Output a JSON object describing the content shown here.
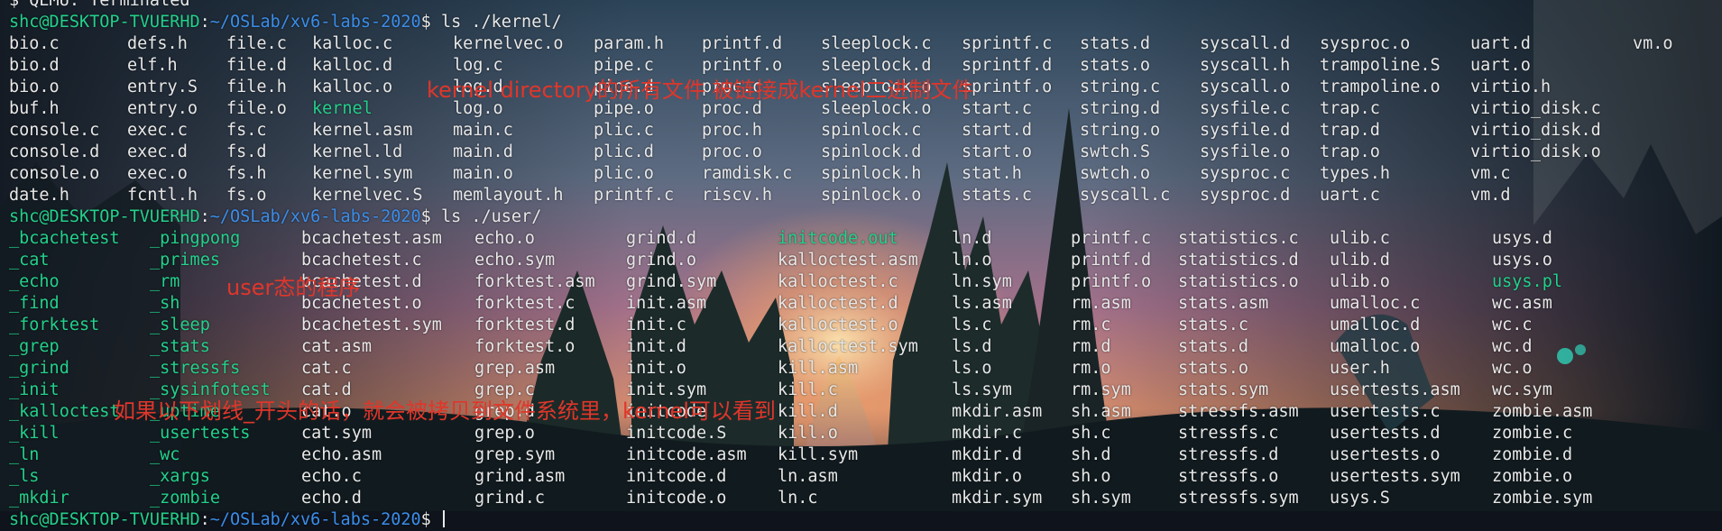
{
  "colors": {
    "exe_green": "#23d18b",
    "path_blue": "#3b8eea",
    "annotation_red": "#e0362a"
  },
  "terminal": {
    "status_line": "$ QEMU: Terminated",
    "kernel_cmd": {
      "user_host": "shc@DESKTOP-TVUERHD",
      "sep": ":",
      "path": "~/OSLab/xv6-labs-2020",
      "command": "$ ls ./kernel/"
    },
    "kernel_rows": [
      [
        "bio.c",
        "defs.h",
        "file.c",
        "kalloc.c",
        "kernelvec.o",
        "param.h",
        "printf.d",
        "sleeplock.c",
        "sprintf.c",
        "stats.d",
        "syscall.d",
        "sysproc.o",
        "uart.d",
        "vm.o"
      ],
      [
        "bio.d",
        "elf.h",
        "file.d",
        "kalloc.d",
        "log.c",
        "pipe.c",
        "printf.o",
        "sleeplock.d",
        "sprintf.d",
        "stats.o",
        "syscall.h",
        "trampoline.S",
        "uart.o",
        ""
      ],
      [
        "bio.o",
        "entry.S",
        "file.h",
        "kalloc.o",
        "log.d",
        "pipe.d",
        "proc.c",
        "sleeplock.o",
        "sprintf.o",
        "string.c",
        "syscall.o",
        "trampoline.o",
        "virtio.h",
        ""
      ],
      [
        "buf.h",
        "entry.o",
        "file.o",
        "kernel",
        "log.o",
        "pipe.o",
        "proc.d",
        "sleeplock.o",
        "start.c",
        "string.d",
        "sysfile.c",
        "trap.c",
        "virtio_disk.c",
        ""
      ],
      [
        "console.c",
        "exec.c",
        "fs.c",
        "kernel.asm",
        "main.c",
        "plic.c",
        "proc.h",
        "spinlock.c",
        "start.d",
        "string.o",
        "sysfile.d",
        "trap.d",
        "virtio_disk.d",
        ""
      ],
      [
        "console.d",
        "exec.d",
        "fs.d",
        "kernel.ld",
        "main.d",
        "plic.d",
        "proc.o",
        "spinlock.d",
        "start.o",
        "swtch.S",
        "sysfile.o",
        "trap.o",
        "virtio_disk.o",
        ""
      ],
      [
        "console.o",
        "exec.o",
        "fs.h",
        "kernel.sym",
        "main.o",
        "plic.o",
        "ramdisk.c",
        "spinlock.h",
        "stat.h",
        "swtch.o",
        "sysproc.c",
        "types.h",
        "vm.c",
        ""
      ],
      [
        "date.h",
        "fcntl.h",
        "fs.o",
        "kernelvec.S",
        "memlayout.h",
        "printf.c",
        "riscv.h",
        "spinlock.o",
        "stats.c",
        "syscall.c",
        "sysproc.d",
        "uart.c",
        "vm.d",
        ""
      ]
    ],
    "user_cmd": {
      "user_host": "shc@DESKTOP-TVUERHD",
      "sep": ":",
      "path": "~/OSLab/xv6-labs-2020",
      "command": "$ ls ./user/"
    },
    "user_rows": [
      [
        "_bcachetest",
        "_pingpong",
        "bcachetest.asm",
        "echo.o",
        "grind.d",
        "initcode.out",
        "ln.d",
        "printf.c",
        "statistics.c",
        "ulib.c",
        "usys.d"
      ],
      [
        "_cat",
        "_primes",
        "bcachetest.c",
        "echo.sym",
        "grind.o",
        "kalloctest.asm",
        "ln.o",
        "printf.d",
        "statistics.d",
        "ulib.d",
        "usys.o"
      ],
      [
        "_echo",
        "_rm",
        "bcachetest.d",
        "forktest.asm",
        "grind.sym",
        "kalloctest.c",
        "ln.sym",
        "printf.o",
        "statistics.o",
        "ulib.o",
        "usys.pl"
      ],
      [
        "_find",
        "_sh",
        "bcachetest.o",
        "forktest.c",
        "init.asm",
        "kalloctest.d",
        "ls.asm",
        "rm.asm",
        "stats.asm",
        "umalloc.c",
        "wc.asm"
      ],
      [
        "_forktest",
        "_sleep",
        "bcachetest.sym",
        "forktest.d",
        "init.c",
        "kalloctest.o",
        "ls.c",
        "rm.c",
        "stats.c",
        "umalloc.d",
        "wc.c"
      ],
      [
        "_grep",
        "_stats",
        "cat.asm",
        "forktest.o",
        "init.d",
        "kalloctest.sym",
        "ls.d",
        "rm.d",
        "stats.d",
        "umalloc.o",
        "wc.d"
      ],
      [
        "_grind",
        "_stressfs",
        "cat.c",
        "grep.asm",
        "init.o",
        "kill.asm",
        "ls.o",
        "rm.o",
        "stats.o",
        "user.h",
        "wc.o"
      ],
      [
        "_init",
        "_sysinfotest",
        "cat.d",
        "grep.c",
        "init.sym",
        "kill.c",
        "ls.sym",
        "rm.sym",
        "stats.sym",
        "usertests.asm",
        "wc.sym"
      ],
      [
        "_kalloctest",
        "_uptime",
        "cat.o",
        "grep.d",
        "initcode",
        "kill.d",
        "mkdir.asm",
        "sh.asm",
        "stressfs.asm",
        "usertests.c",
        "zombie.asm"
      ],
      [
        "_kill",
        "_usertests",
        "cat.sym",
        "grep.o",
        "initcode.S",
        "kill.o",
        "mkdir.c",
        "sh.c",
        "stressfs.c",
        "usertests.d",
        "zombie.c"
      ],
      [
        "_ln",
        "_wc",
        "echo.asm",
        "grep.sym",
        "initcode.asm",
        "kill.sym",
        "mkdir.d",
        "sh.d",
        "stressfs.d",
        "usertests.o",
        "zombie.d"
      ],
      [
        "_ls",
        "_xargs",
        "echo.c",
        "grind.asm",
        "initcode.d",
        "ln.asm",
        "mkdir.o",
        "sh.o",
        "stressfs.o",
        "usertests.sym",
        "zombie.o"
      ],
      [
        "_mkdir",
        "_zombie",
        "echo.d",
        "grind.c",
        "initcode.o",
        "ln.c",
        "mkdir.sym",
        "sh.sym",
        "stressfs.sym",
        "usys.S",
        "zombie.sym"
      ]
    ],
    "final_prompt": {
      "user_host": "shc@DESKTOP-TVUERHD",
      "sep": ":",
      "path": "~/OSLab/xv6-labs-2020",
      "command": "$ "
    }
  },
  "annotations": {
    "kernel_note": "kernel directory的所有文件 被链接成kernel二进制文件",
    "user_note": "user态的程序",
    "underscore_note": "如果以下划线_开头的话，就会被拷贝到文件系统里，kernel可以看到"
  }
}
